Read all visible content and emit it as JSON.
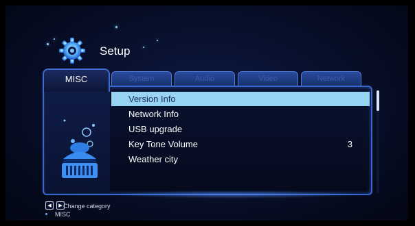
{
  "header": {
    "title": "Setup"
  },
  "tabs": [
    {
      "label": "MISC",
      "active": true
    },
    {
      "label": "System",
      "active": false
    },
    {
      "label": "Audio",
      "active": false
    },
    {
      "label": "Video",
      "active": false
    },
    {
      "label": "Network",
      "active": false
    }
  ],
  "menu": {
    "items": [
      {
        "label": "Version Info",
        "value": "",
        "selected": true
      },
      {
        "label": "Network Info",
        "value": "",
        "selected": false
      },
      {
        "label": "USB upgrade",
        "value": "",
        "selected": false
      },
      {
        "label": "Key Tone Volume",
        "value": "3",
        "selected": false
      },
      {
        "label": "Weather city",
        "value": "",
        "selected": false
      }
    ]
  },
  "footer": {
    "hint_label": "Change category",
    "current_category": "MISC",
    "left_icon": "arrow-left-icon",
    "right_icon": "arrow-right-icon"
  },
  "colors": {
    "background": "#08102c",
    "selected_row": "#97d4f1",
    "accent_border": "#3a66cc"
  }
}
